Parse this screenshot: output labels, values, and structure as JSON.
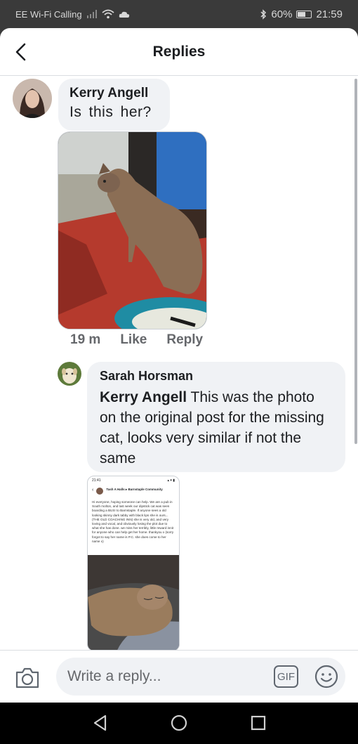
{
  "status_bar": {
    "carrier": "EE Wi-Fi Calling",
    "battery": "60%",
    "battery_level": 0.6,
    "time": "21:59",
    "icons": [
      "signal-icon",
      "wifi-icon",
      "cloud-icon",
      "bluetooth-icon",
      "battery-icon"
    ]
  },
  "header": {
    "title": "Replies",
    "back_icon": "chevron-left-icon"
  },
  "comments": [
    {
      "author": "Kerry Angell",
      "text": "Is this her?",
      "timestamp": "19 m",
      "like_label": "Like",
      "reply_label": "Reply"
    },
    {
      "author": "Sarah Horsman",
      "mention": "Kerry Angell",
      "text": " This was the photo on the original post for the missing cat, looks very similar if not the same"
    }
  ],
  "embedded_screenshot": {
    "time": "21:41",
    "group_header": "Tash A Halls ▸ Barnstaple Community",
    "post_text": "Hi everyone, hoping someone can help. We are a pub in South molton, and last week our dipstick cat was seen boarding a BUS! to Barnstaple. If anyone sees a old looking skinny dark tabby with black lips she is ours... (THE OLD COACHING INN) she is very old, and very loving and vocal, and obviously losing the plot due to what she has done. we miss her terribly, little reward innit for anyone who can help get her home. thankyou x (sorry forgot to say her name is P.C. she does come to her name x)"
  },
  "input": {
    "placeholder": "Write a reply...",
    "gif_label": "GIF"
  },
  "colors": {
    "bubble": "#f0f2f5",
    "secondary_text": "#65676b",
    "divider": "#dadde1"
  }
}
